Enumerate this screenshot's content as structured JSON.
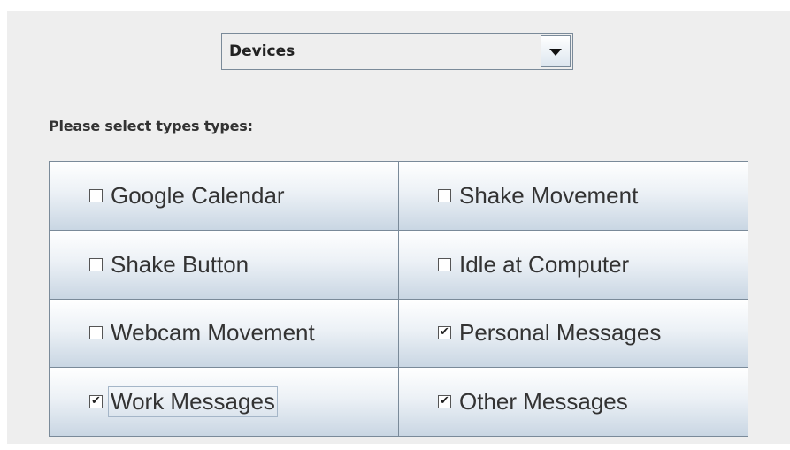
{
  "combo": {
    "value": "Devices"
  },
  "prompt": "Please select types types:",
  "options": [
    {
      "label": "Google Calendar",
      "checked": false
    },
    {
      "label": "Shake Movement",
      "checked": false
    },
    {
      "label": "Shake Button",
      "checked": false
    },
    {
      "label": "Idle at Computer",
      "checked": false
    },
    {
      "label": "Webcam Movement",
      "checked": false
    },
    {
      "label": "Personal Messages",
      "checked": true
    },
    {
      "label": "Work Messages",
      "checked": true
    },
    {
      "label": "Other Messages",
      "checked": true
    }
  ],
  "icons": {
    "combo_arrow": "chevron-down-icon",
    "check_mark": "check-icon"
  },
  "colors": {
    "panel_background": "#eeeeee",
    "border": "#7a8a99",
    "text": "#333333"
  }
}
